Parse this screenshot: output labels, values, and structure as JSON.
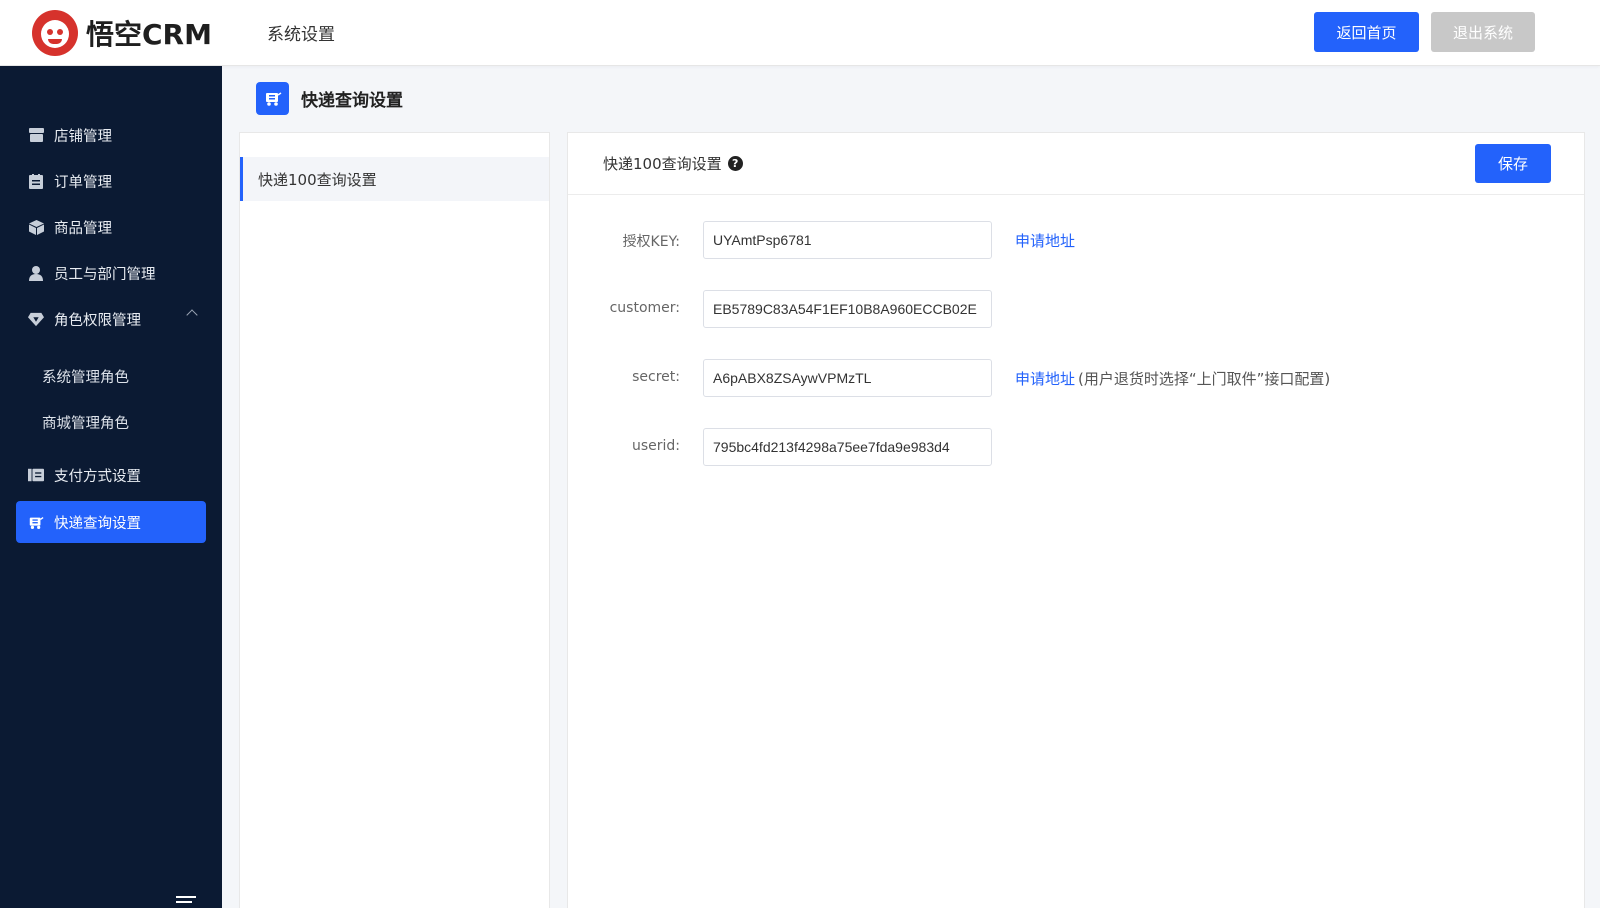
{
  "app": {
    "logo_text": "悟空CRM",
    "header_title": "系统设置",
    "btn_home": "返回首页",
    "btn_exit": "退出系统"
  },
  "sidebar": {
    "items": [
      {
        "label": "店铺管理",
        "icon": "store-icon"
      },
      {
        "label": "订单管理",
        "icon": "order-icon"
      },
      {
        "label": "商品管理",
        "icon": "box-icon"
      },
      {
        "label": "员工与部门管理",
        "icon": "user-icon"
      },
      {
        "label": "角色权限管理",
        "icon": "diamond-icon"
      },
      {
        "label": "支付方式设置",
        "icon": "payment-icon"
      },
      {
        "label": "快递查询设置",
        "icon": "express-icon"
      }
    ],
    "sub_items": [
      {
        "label": "系统管理角色"
      },
      {
        "label": "商城管理角色"
      }
    ],
    "active": "快递查询设置"
  },
  "page": {
    "title": "快递查询设置"
  },
  "left_panel": {
    "items": [
      {
        "label": "快递100查询设置"
      }
    ]
  },
  "main": {
    "title": "快递100查询设置",
    "save_label": "保存",
    "fields": [
      {
        "label": "授权KEY:",
        "value": "UYAmtPsp6781",
        "link": "申请地址",
        "note": ""
      },
      {
        "label": "customer:",
        "value": "EB5789C83A54F1EF10B8A960ECCB02E",
        "link": "",
        "note": ""
      },
      {
        "label": "secret:",
        "value": "A6pABX8ZSAywVPMzTL",
        "link": "申请地址",
        "note": "(用户退货时选择“上门取件”接口配置)"
      },
      {
        "label": "userid:",
        "value": "795bc4fd213f4298a75ee7fda9e983d4",
        "link": "",
        "note": ""
      }
    ]
  },
  "colors": {
    "primary": "#2362fb",
    "sidebar_bg": "#0b1a33",
    "logo_red": "#d6322c",
    "disabled_btn": "#c8c8c8"
  }
}
